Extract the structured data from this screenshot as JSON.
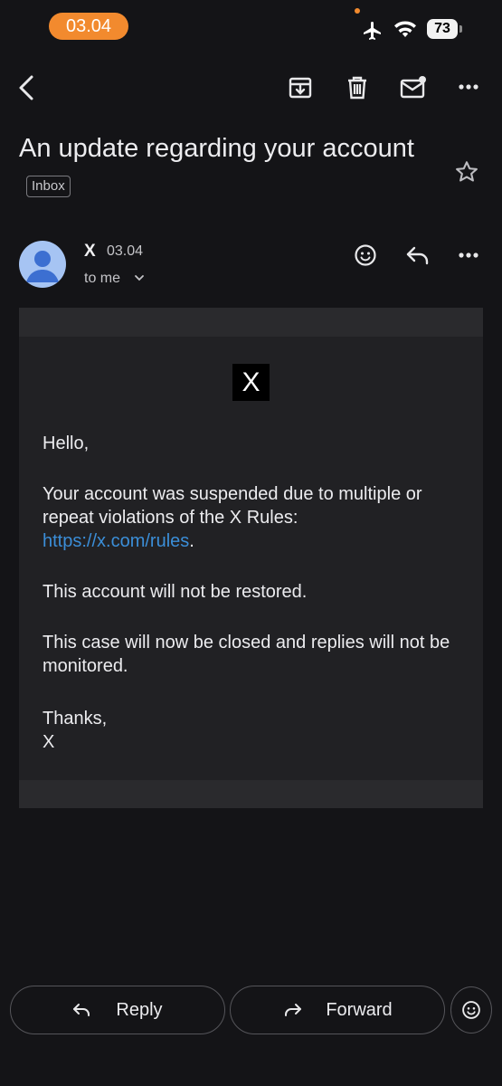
{
  "status_bar": {
    "time": "03.04",
    "battery": "73",
    "icons": [
      "airplane-icon",
      "wifi-icon",
      "battery-icon"
    ]
  },
  "toolbar": {
    "icons": [
      "back-icon",
      "archive-icon",
      "delete-icon",
      "mark-unread-icon",
      "more-icon"
    ]
  },
  "email": {
    "subject": "An update regarding your account",
    "label": "Inbox",
    "sender": "X",
    "date": "03.04",
    "recipient": "to me",
    "logo_text": "X",
    "body": {
      "greeting": "Hello,",
      "p1": "Your account was suspended due to multiple or repeat violations of the X Rules:",
      "link": "https://x.com/rules",
      "link_suffix": ".",
      "p2": "This account will not be restored.",
      "p3": "This case will now be closed and replies will not be monitored.",
      "signoff": "Thanks,",
      "signature": "X"
    }
  },
  "actions": {
    "reply": "Reply",
    "forward": "Forward"
  },
  "colors": {
    "background": "#141417",
    "status_accent": "#f28a2e",
    "link": "#3b8ed8",
    "avatar": "#a6c4f3"
  }
}
